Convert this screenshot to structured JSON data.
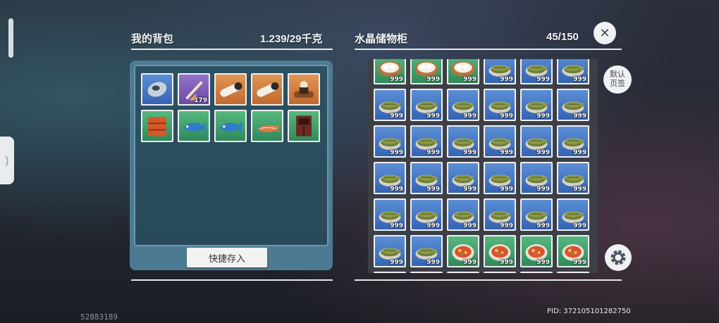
{
  "backpack": {
    "title": "我的背包",
    "weight": "1.239/29千克",
    "quick_store_label": "快捷存入",
    "items": [
      {
        "name": "silver-lure-icon",
        "quality": "blue",
        "count": ""
      },
      {
        "name": "feather-quiver-icon",
        "quality": "purple",
        "count": "179"
      },
      {
        "name": "telescope-scroll-icon",
        "quality": "orange",
        "count": ""
      },
      {
        "name": "telescope-scroll-icon",
        "quality": "orange",
        "count": ""
      },
      {
        "name": "chef-figure-icon",
        "quality": "orange",
        "count": ""
      },
      {
        "name": "orange-crate-icon",
        "quality": "green",
        "count": ""
      },
      {
        "name": "blue-fish-icon",
        "quality": "green",
        "count": ""
      },
      {
        "name": "blue-fish-icon",
        "quality": "green",
        "count": ""
      },
      {
        "name": "orange-fish-icon",
        "quality": "green",
        "count": ""
      },
      {
        "name": "brown-cabinet-icon",
        "quality": "green",
        "count": ""
      }
    ]
  },
  "storage": {
    "title": "水晶储物柜",
    "capacity": "45/150",
    "default_tab_label": "默认\n页签",
    "rows": [
      [
        {
          "item": "dumpling-plate-icon",
          "quality": "green",
          "count": "999"
        },
        {
          "item": "dumpling-plate-icon",
          "quality": "green",
          "count": "999"
        },
        {
          "item": "dumpling-plate-icon",
          "quality": "green",
          "count": "999"
        },
        {
          "item": "fish-dish-icon",
          "quality": "blue",
          "count": "999"
        },
        {
          "item": "fish-dish-icon",
          "quality": "blue",
          "count": "999"
        },
        {
          "item": "fish-dish-icon",
          "quality": "blue",
          "count": "999"
        }
      ],
      [
        {
          "item": "fish-dish-icon",
          "quality": "blue",
          "count": "999"
        },
        {
          "item": "fish-dish-icon",
          "quality": "blue",
          "count": "999"
        },
        {
          "item": "fish-dish-icon",
          "quality": "blue",
          "count": "999"
        },
        {
          "item": "fish-dish-icon",
          "quality": "blue",
          "count": "999"
        },
        {
          "item": "fish-dish-icon",
          "quality": "blue",
          "count": "999"
        },
        {
          "item": "fish-dish-icon",
          "quality": "blue",
          "count": "999"
        }
      ],
      [
        {
          "item": "fish-dish-icon",
          "quality": "blue",
          "count": "999"
        },
        {
          "item": "fish-dish-icon",
          "quality": "blue",
          "count": "999"
        },
        {
          "item": "fish-dish-icon",
          "quality": "blue",
          "count": "999"
        },
        {
          "item": "fish-dish-icon",
          "quality": "blue",
          "count": "999"
        },
        {
          "item": "fish-dish-icon",
          "quality": "blue",
          "count": "999"
        },
        {
          "item": "fish-dish-icon",
          "quality": "blue",
          "count": "999"
        }
      ],
      [
        {
          "item": "fish-dish-icon",
          "quality": "blue",
          "count": "999"
        },
        {
          "item": "fish-dish-icon",
          "quality": "blue",
          "count": "999"
        },
        {
          "item": "fish-dish-icon",
          "quality": "blue",
          "count": "999"
        },
        {
          "item": "fish-dish-icon",
          "quality": "blue",
          "count": "999"
        },
        {
          "item": "fish-dish-icon",
          "quality": "blue",
          "count": "999"
        },
        {
          "item": "fish-dish-icon",
          "quality": "blue",
          "count": "999"
        }
      ],
      [
        {
          "item": "fish-dish-icon",
          "quality": "blue",
          "count": "999"
        },
        {
          "item": "fish-dish-icon",
          "quality": "blue",
          "count": "999"
        },
        {
          "item": "fish-dish-icon",
          "quality": "blue",
          "count": "999"
        },
        {
          "item": "fish-dish-icon",
          "quality": "blue",
          "count": "999"
        },
        {
          "item": "fish-dish-icon",
          "quality": "blue",
          "count": "999"
        },
        {
          "item": "fish-dish-icon",
          "quality": "blue",
          "count": "999"
        }
      ],
      [
        {
          "item": "fish-dish-icon",
          "quality": "blue",
          "count": "999"
        },
        {
          "item": "fish-dish-icon",
          "quality": "blue",
          "count": "999"
        },
        {
          "item": "tomato-soup-icon",
          "quality": "green",
          "count": "999"
        },
        {
          "item": "tomato-soup-icon",
          "quality": "green",
          "count": "999"
        },
        {
          "item": "tomato-soup-icon",
          "quality": "green",
          "count": "999"
        },
        {
          "item": "tomato-soup-icon",
          "quality": "green",
          "count": "999"
        }
      ],
      [
        {
          "item": "fish-dish-icon",
          "quality": "blue",
          "count": ""
        },
        {
          "item": "fish-dish-icon",
          "quality": "blue",
          "count": ""
        },
        {
          "item": "fish-dish-icon",
          "quality": "blue",
          "count": ""
        },
        {
          "item": "fish-dish-icon",
          "quality": "blue",
          "count": ""
        },
        {
          "item": "fish-dish-icon",
          "quality": "blue",
          "count": ""
        },
        {
          "item": "fish-dish-icon",
          "quality": "blue",
          "count": ""
        }
      ]
    ]
  },
  "footer": {
    "left_id": "52883189",
    "pid": "PID: 372105101282750"
  },
  "colors": {
    "blue_quality": "#3563b3",
    "green_quality": "#2f8a5a",
    "purple_quality": "#6a4aa4",
    "orange_quality": "#bf6a2f",
    "panel_teal": "#4d7a93"
  }
}
